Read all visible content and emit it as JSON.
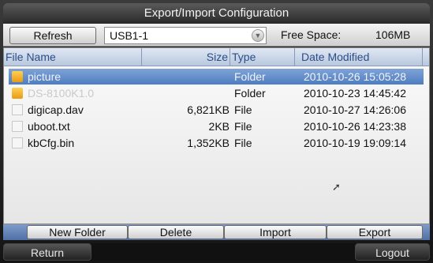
{
  "window": {
    "title": "Export/Import Configuration"
  },
  "toolbar": {
    "refresh_label": "Refresh",
    "device_selected": "USB1-1",
    "free_space_label": "Free Space:",
    "free_space_value": "106MB"
  },
  "list": {
    "columns": {
      "name": "File Name",
      "size": "Size",
      "type": "Type",
      "date": "Date Modified"
    },
    "rows": [
      {
        "name": "picture",
        "size": "",
        "type": "Folder",
        "date": "2010-10-26 15:05:28",
        "icon": "folder-icon",
        "selected": true
      },
      {
        "name": "DS-8100K1.0",
        "size": "",
        "type": "Folder",
        "date": "2010-10-23 14:45:42",
        "icon": "folder-icon",
        "selected": false
      },
      {
        "name": "digicap.dav",
        "size": "6,821KB",
        "type": "File",
        "date": "2010-10-27 14:26:06",
        "icon": "file-icon",
        "selected": false
      },
      {
        "name": "uboot.txt",
        "size": "2KB",
        "type": "File",
        "date": "2010-10-26 14:23:38",
        "icon": "file-icon",
        "selected": false
      },
      {
        "name": "kbCfg.bin",
        "size": "1,352KB",
        "type": "File",
        "date": "2010-10-19 19:09:14",
        "icon": "file-icon",
        "selected": false
      }
    ]
  },
  "actions": {
    "new_folder": "New Folder",
    "delete": "Delete",
    "import": "Import",
    "export": "Export"
  },
  "footer": {
    "return_label": "Return",
    "logout_label": "Logout"
  },
  "colors": {
    "selection": "#4f7dc2",
    "header_text": "#2b4d88",
    "folder": "#f0a826"
  }
}
